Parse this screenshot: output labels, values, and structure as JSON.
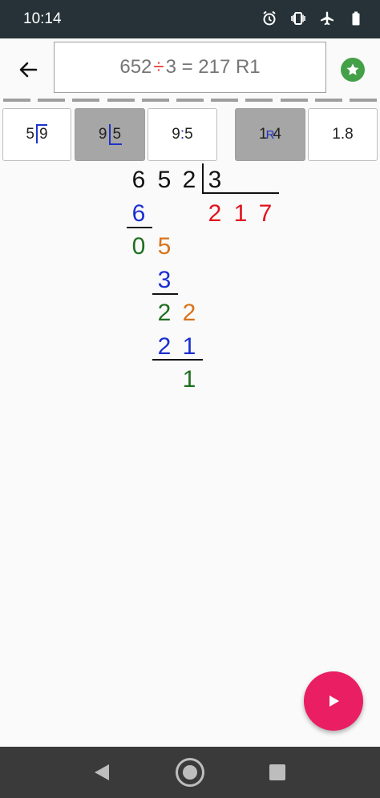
{
  "status_bar": {
    "time": "10:14",
    "icons": [
      "alarm-icon",
      "vibrate-icon",
      "airplane-icon",
      "battery-icon"
    ]
  },
  "app_bar": {
    "back_icon": "arrow-left-icon",
    "expression": {
      "dividend": "652",
      "operator": "÷",
      "rest": "3 = 217 R1"
    },
    "favorite_icon": "star-icon"
  },
  "notations": [
    {
      "left": "5",
      "right": "9",
      "selected": false
    },
    {
      "left": "9",
      "right": "5",
      "selected": true
    },
    {
      "left": "9",
      "sep": ":",
      "right": "5",
      "selected": false
    },
    {
      "left": "1",
      "mark": "R",
      "right": "4",
      "selected": true
    },
    {
      "text": "1.8",
      "selected": false
    }
  ],
  "long_division": {
    "dividend_digits": [
      "6",
      "5",
      "2"
    ],
    "divisor": "3",
    "quotient_digits": [
      "2",
      "1",
      "7"
    ],
    "steps": {
      "sub1": "6",
      "rem1_a": "0",
      "rem1_b": "5",
      "sub2": "3",
      "rem2_a": "2",
      "rem2_b": "2",
      "sub3_a": "2",
      "sub3_b": "1",
      "final_remainder": "1"
    }
  },
  "fab": {
    "icon": "play-icon"
  },
  "nav_bar": {
    "icons": [
      "nav-back-icon",
      "nav-home-icon",
      "nav-recents-icon"
    ]
  },
  "colors": {
    "status_bar": "#263238",
    "accent_fab": "#e91e63",
    "star": "#43a047",
    "quotient": "#e0141e",
    "subtract": "#1a2fd0",
    "remainder": "#1f6f1f",
    "bring_down": "#d9731a"
  }
}
